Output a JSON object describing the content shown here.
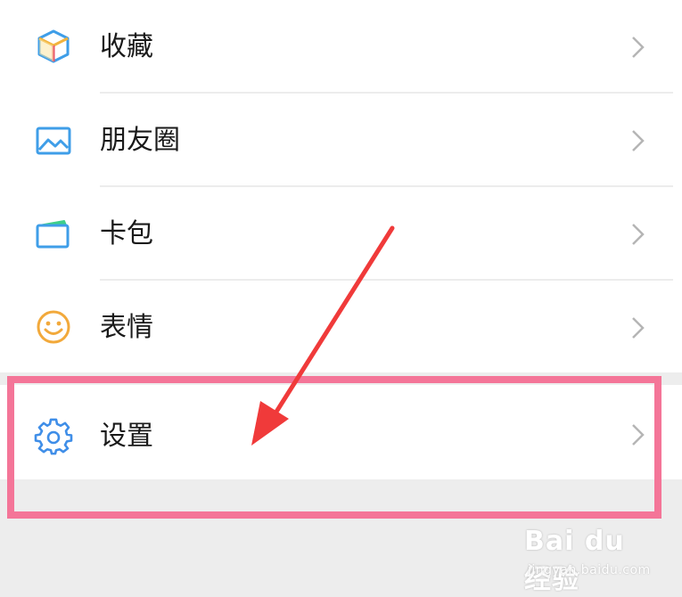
{
  "menu": {
    "items": [
      {
        "label": "收藏",
        "icon": "cube-icon"
      },
      {
        "label": "朋友圈",
        "icon": "photo-icon"
      },
      {
        "label": "卡包",
        "icon": "card-wallet-icon"
      },
      {
        "label": "表情",
        "icon": "smiley-icon"
      }
    ],
    "settings": {
      "label": "设置",
      "icon": "gear-icon"
    }
  },
  "annotation": {
    "highlight_color": "#f47598",
    "arrow_color": "#f03a3a"
  },
  "watermark": {
    "brand": "Bai du 经验",
    "url": "jingyan.baidu.com"
  }
}
